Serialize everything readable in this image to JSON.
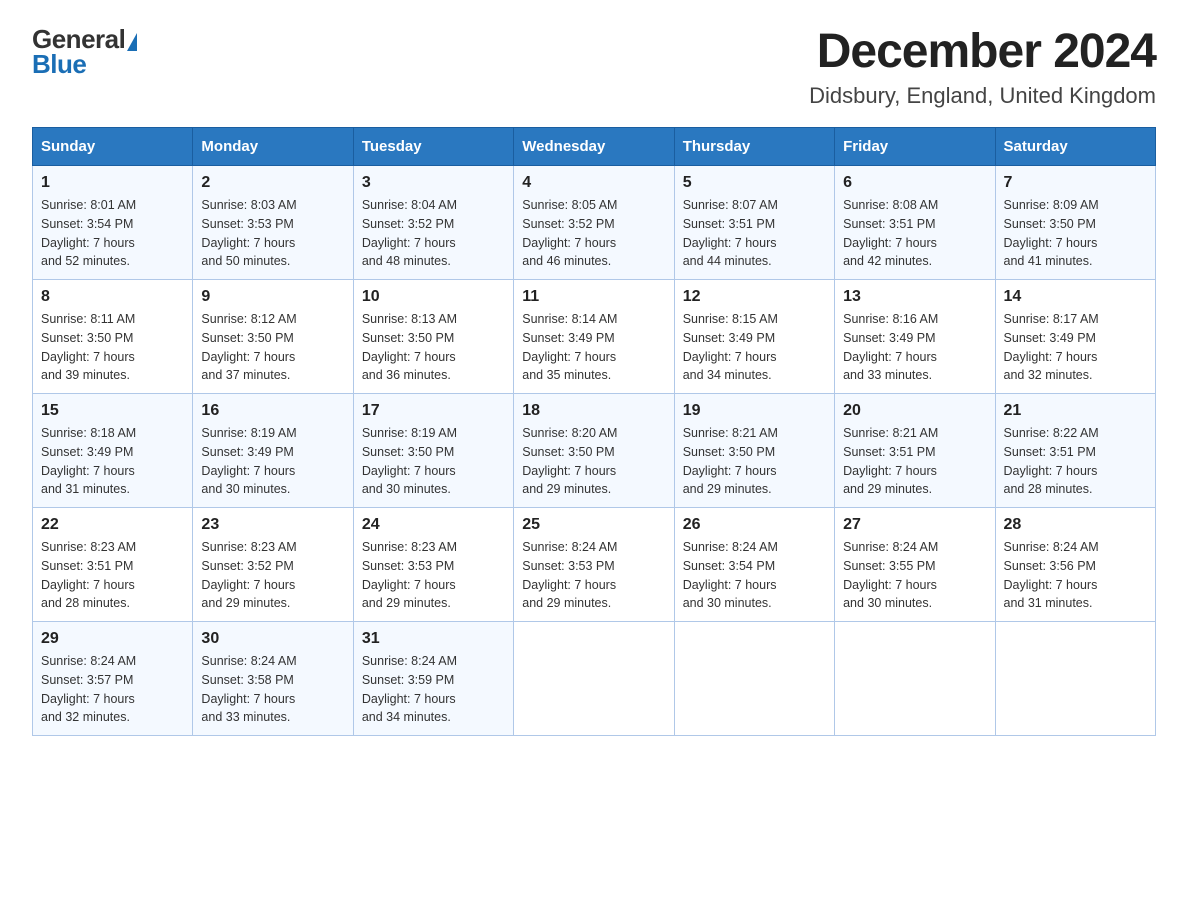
{
  "logo": {
    "general": "General",
    "blue": "Blue"
  },
  "title": "December 2024",
  "subtitle": "Didsbury, England, United Kingdom",
  "weekdays": [
    "Sunday",
    "Monday",
    "Tuesday",
    "Wednesday",
    "Thursday",
    "Friday",
    "Saturday"
  ],
  "weeks": [
    [
      {
        "day": "1",
        "sunrise": "8:01 AM",
        "sunset": "3:54 PM",
        "daylight": "7 hours and 52 minutes."
      },
      {
        "day": "2",
        "sunrise": "8:03 AM",
        "sunset": "3:53 PM",
        "daylight": "7 hours and 50 minutes."
      },
      {
        "day": "3",
        "sunrise": "8:04 AM",
        "sunset": "3:52 PM",
        "daylight": "7 hours and 48 minutes."
      },
      {
        "day": "4",
        "sunrise": "8:05 AM",
        "sunset": "3:52 PM",
        "daylight": "7 hours and 46 minutes."
      },
      {
        "day": "5",
        "sunrise": "8:07 AM",
        "sunset": "3:51 PM",
        "daylight": "7 hours and 44 minutes."
      },
      {
        "day": "6",
        "sunrise": "8:08 AM",
        "sunset": "3:51 PM",
        "daylight": "7 hours and 42 minutes."
      },
      {
        "day": "7",
        "sunrise": "8:09 AM",
        "sunset": "3:50 PM",
        "daylight": "7 hours and 41 minutes."
      }
    ],
    [
      {
        "day": "8",
        "sunrise": "8:11 AM",
        "sunset": "3:50 PM",
        "daylight": "7 hours and 39 minutes."
      },
      {
        "day": "9",
        "sunrise": "8:12 AM",
        "sunset": "3:50 PM",
        "daylight": "7 hours and 37 minutes."
      },
      {
        "day": "10",
        "sunrise": "8:13 AM",
        "sunset": "3:50 PM",
        "daylight": "7 hours and 36 minutes."
      },
      {
        "day": "11",
        "sunrise": "8:14 AM",
        "sunset": "3:49 PM",
        "daylight": "7 hours and 35 minutes."
      },
      {
        "day": "12",
        "sunrise": "8:15 AM",
        "sunset": "3:49 PM",
        "daylight": "7 hours and 34 minutes."
      },
      {
        "day": "13",
        "sunrise": "8:16 AM",
        "sunset": "3:49 PM",
        "daylight": "7 hours and 33 minutes."
      },
      {
        "day": "14",
        "sunrise": "8:17 AM",
        "sunset": "3:49 PM",
        "daylight": "7 hours and 32 minutes."
      }
    ],
    [
      {
        "day": "15",
        "sunrise": "8:18 AM",
        "sunset": "3:49 PM",
        "daylight": "7 hours and 31 minutes."
      },
      {
        "day": "16",
        "sunrise": "8:19 AM",
        "sunset": "3:49 PM",
        "daylight": "7 hours and 30 minutes."
      },
      {
        "day": "17",
        "sunrise": "8:19 AM",
        "sunset": "3:50 PM",
        "daylight": "7 hours and 30 minutes."
      },
      {
        "day": "18",
        "sunrise": "8:20 AM",
        "sunset": "3:50 PM",
        "daylight": "7 hours and 29 minutes."
      },
      {
        "day": "19",
        "sunrise": "8:21 AM",
        "sunset": "3:50 PM",
        "daylight": "7 hours and 29 minutes."
      },
      {
        "day": "20",
        "sunrise": "8:21 AM",
        "sunset": "3:51 PM",
        "daylight": "7 hours and 29 minutes."
      },
      {
        "day": "21",
        "sunrise": "8:22 AM",
        "sunset": "3:51 PM",
        "daylight": "7 hours and 28 minutes."
      }
    ],
    [
      {
        "day": "22",
        "sunrise": "8:23 AM",
        "sunset": "3:51 PM",
        "daylight": "7 hours and 28 minutes."
      },
      {
        "day": "23",
        "sunrise": "8:23 AM",
        "sunset": "3:52 PM",
        "daylight": "7 hours and 29 minutes."
      },
      {
        "day": "24",
        "sunrise": "8:23 AM",
        "sunset": "3:53 PM",
        "daylight": "7 hours and 29 minutes."
      },
      {
        "day": "25",
        "sunrise": "8:24 AM",
        "sunset": "3:53 PM",
        "daylight": "7 hours and 29 minutes."
      },
      {
        "day": "26",
        "sunrise": "8:24 AM",
        "sunset": "3:54 PM",
        "daylight": "7 hours and 30 minutes."
      },
      {
        "day": "27",
        "sunrise": "8:24 AM",
        "sunset": "3:55 PM",
        "daylight": "7 hours and 30 minutes."
      },
      {
        "day": "28",
        "sunrise": "8:24 AM",
        "sunset": "3:56 PM",
        "daylight": "7 hours and 31 minutes."
      }
    ],
    [
      {
        "day": "29",
        "sunrise": "8:24 AM",
        "sunset": "3:57 PM",
        "daylight": "7 hours and 32 minutes."
      },
      {
        "day": "30",
        "sunrise": "8:24 AM",
        "sunset": "3:58 PM",
        "daylight": "7 hours and 33 minutes."
      },
      {
        "day": "31",
        "sunrise": "8:24 AM",
        "sunset": "3:59 PM",
        "daylight": "7 hours and 34 minutes."
      },
      null,
      null,
      null,
      null
    ]
  ],
  "labels": {
    "sunrise": "Sunrise:",
    "sunset": "Sunset:",
    "daylight": "Daylight:"
  }
}
